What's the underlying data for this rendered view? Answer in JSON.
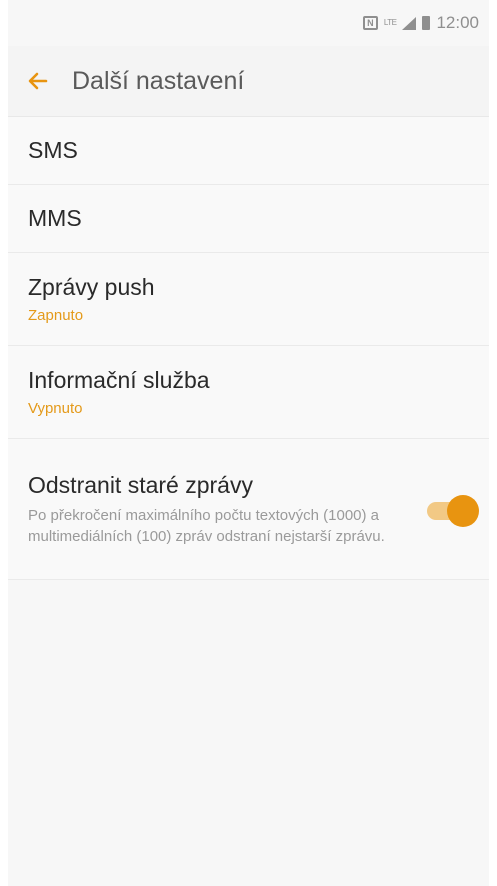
{
  "status_bar": {
    "nfc": "N",
    "network": "LTE",
    "time": "12:00"
  },
  "header": {
    "title": "Další nastavení"
  },
  "items": [
    {
      "title": "SMS"
    },
    {
      "title": "MMS"
    },
    {
      "title": "Zprávy push",
      "status": "Zapnuto"
    },
    {
      "title": "Informační služba",
      "status": "Vypnuto"
    },
    {
      "title": "Odstranit staré zprávy",
      "description": "Po překročení maximálního počtu textových (1000) a multimediálních (100) zpráv odstraní nejstarší zprávu.",
      "toggle_on": true
    }
  ],
  "colors": {
    "accent": "#e89410",
    "accent_light": "#f2c985",
    "status_text": "#e49a1a"
  },
  "icons": {
    "back": "arrow-left-icon",
    "nfc": "nfc-icon",
    "signal": "signal-icon",
    "battery": "battery-icon"
  }
}
